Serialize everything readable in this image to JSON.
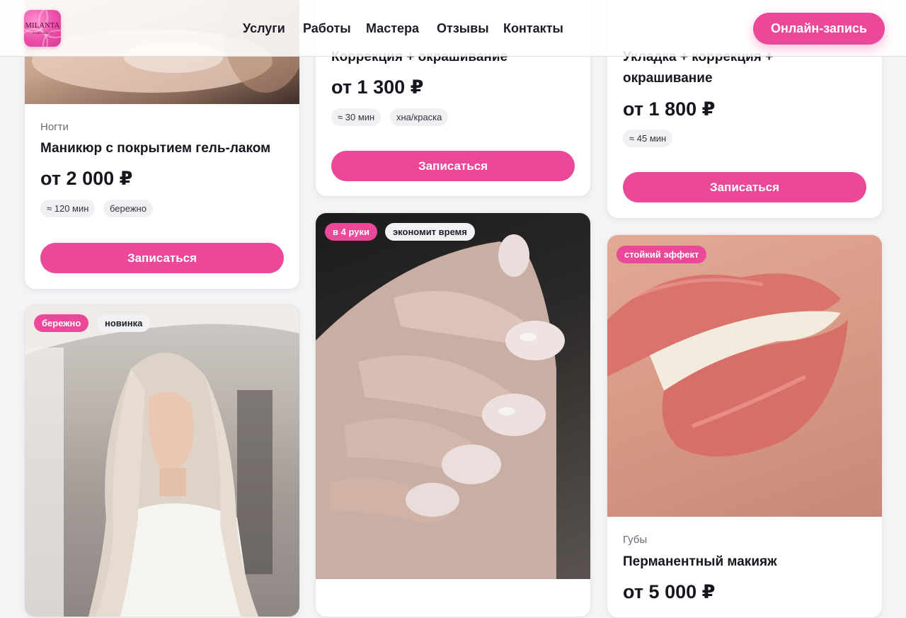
{
  "header": {
    "logo_text": "MILANTA",
    "logo_sub": "STUDIO BEAUTY",
    "nav": [
      "Услуги",
      "Работы",
      "Мастера",
      "Отзывы",
      "Контакты"
    ],
    "cta": "Онлайн-запись"
  },
  "cards": {
    "manicure": {
      "category": "Ногти",
      "title": "Маникюр с покрытием гель-лаком",
      "price": "от 2 000 ₽",
      "chips": [
        "≈ 120 мин",
        "бережно"
      ],
      "button": "Записаться"
    },
    "brows": {
      "title": "Коррекция + окрашивание",
      "price": "от 1 300 ₽",
      "chips": [
        "≈ 30 мин",
        "хна/краска"
      ],
      "button": "Записаться"
    },
    "styling": {
      "title_line1": "Укладка + коррекция +",
      "title_line2": "окрашивание",
      "price": "от 1 800 ₽",
      "chips": [
        "≈ 45 мин"
      ],
      "button": "Записаться"
    },
    "hair": {
      "badges": [
        "бережно",
        "новинка"
      ]
    },
    "nails": {
      "badges": [
        "в 4 руки",
        "экономит время"
      ]
    },
    "lips": {
      "badges": [
        "стойкий эффект"
      ],
      "category": "Губы",
      "title": "Перманентный макияж",
      "price": "от 5 000 ₽"
    }
  },
  "colors": {
    "accent": "#ec4899",
    "text": "#16161e",
    "muted": "#6a6a76",
    "chip": "#f0f0f3"
  }
}
